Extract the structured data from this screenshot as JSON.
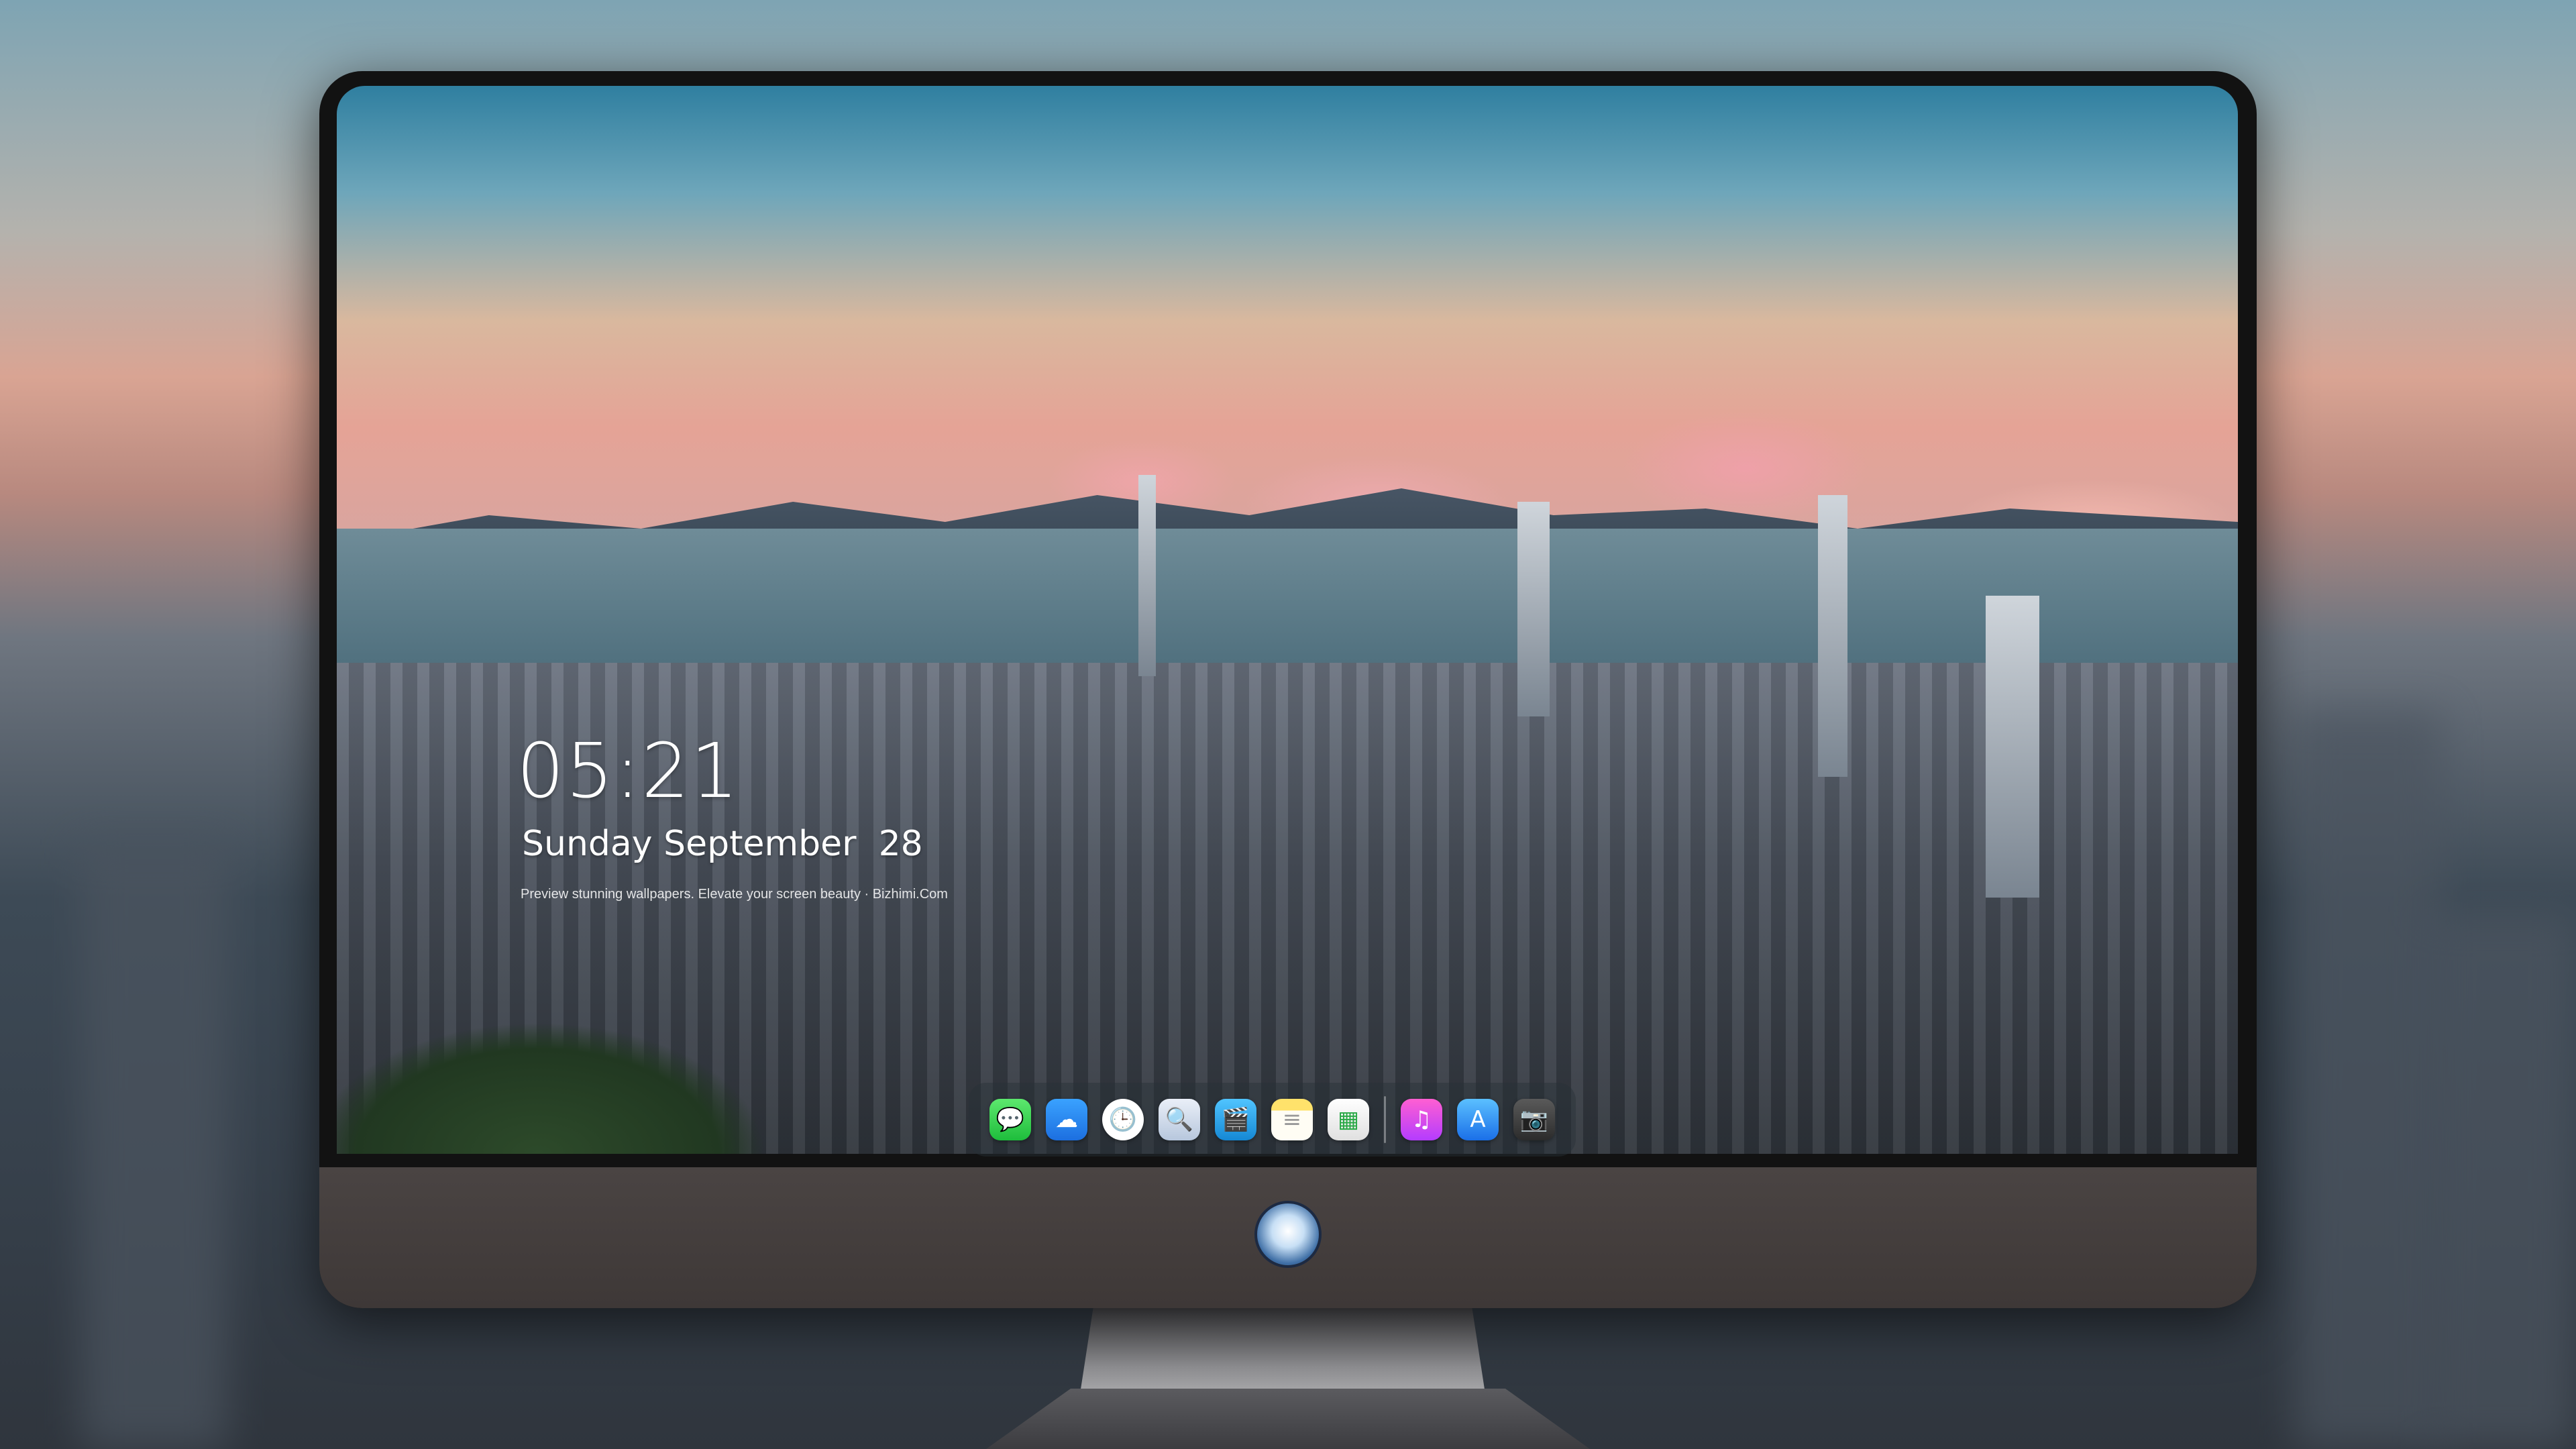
{
  "lockscreen": {
    "time": "05:21",
    "date": "Sunday September  28",
    "caption": "Preview stunning wallpapers. Elevate your screen beauty · Bizhimi.Com"
  },
  "dock": {
    "apps": [
      {
        "name": "Messages",
        "glyph": "💬"
      },
      {
        "name": "Weather",
        "glyph": "☁"
      },
      {
        "name": "Clock",
        "glyph": "🕒"
      },
      {
        "name": "Preview",
        "glyph": "🔍"
      },
      {
        "name": "Clips",
        "glyph": "🎬"
      },
      {
        "name": "Notes",
        "glyph": "≡"
      },
      {
        "name": "Numbers",
        "glyph": "▦"
      },
      {
        "name": "Music",
        "glyph": "♫"
      },
      {
        "name": "App Store",
        "glyph": "A"
      },
      {
        "name": "Camera",
        "glyph": "📷"
      }
    ]
  },
  "colors": {
    "dock_bg": "rgba(40,48,56,.45)",
    "monitor_chin": "#4a4443"
  }
}
